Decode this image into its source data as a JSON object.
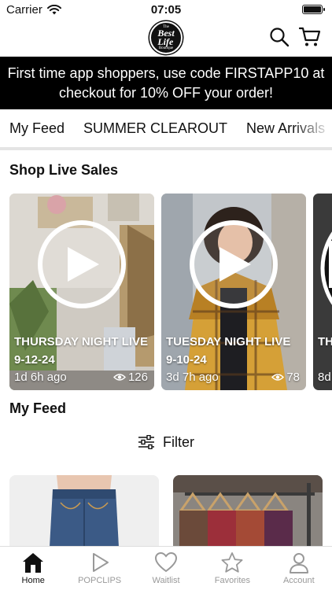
{
  "status_bar": {
    "carrier": "Carrier",
    "time": "07:05"
  },
  "header": {
    "logo_top": "The Best",
    "logo_main": "Best Life",
    "logo_bottom": "Boutique",
    "icons": [
      "search-icon",
      "cart-icon"
    ]
  },
  "promo": {
    "text": "First time app shoppers, use code FIRSTAPP10 at checkout for 10% OFF your order!"
  },
  "tabs": [
    {
      "label": "My Feed",
      "active": true
    },
    {
      "label": "SUMMER CLEAROUT",
      "active": false
    },
    {
      "label": "New Arrivals",
      "active": false
    }
  ],
  "live_section": {
    "title": "Shop Live Sales",
    "cards": [
      {
        "title": "THURSDAY NIGHT LIVE 9-12-24",
        "ago": "1d 6h ago",
        "views": "126"
      },
      {
        "title": "TUESDAY NIGHT LIVE 9-10-24",
        "ago": "3d 7h ago",
        "views": "78"
      },
      {
        "title": "TH LIV",
        "ago": "8d",
        "views": ""
      }
    ]
  },
  "feed_section": {
    "title": "My Feed",
    "filter_label": "Filter"
  },
  "bottom_nav": [
    {
      "label": "Home",
      "icon": "home-icon",
      "active": true
    },
    {
      "label": "POPCLIPS",
      "icon": "play-icon",
      "active": false
    },
    {
      "label": "Waitlist",
      "icon": "heart-icon",
      "active": false
    },
    {
      "label": "Favorites",
      "icon": "star-icon",
      "active": false
    },
    {
      "label": "Account",
      "icon": "account-icon",
      "active": false
    }
  ],
  "colors": {
    "banner_bg": "#000000",
    "banner_text": "#ffffff",
    "inactive_nav": "#999999"
  }
}
